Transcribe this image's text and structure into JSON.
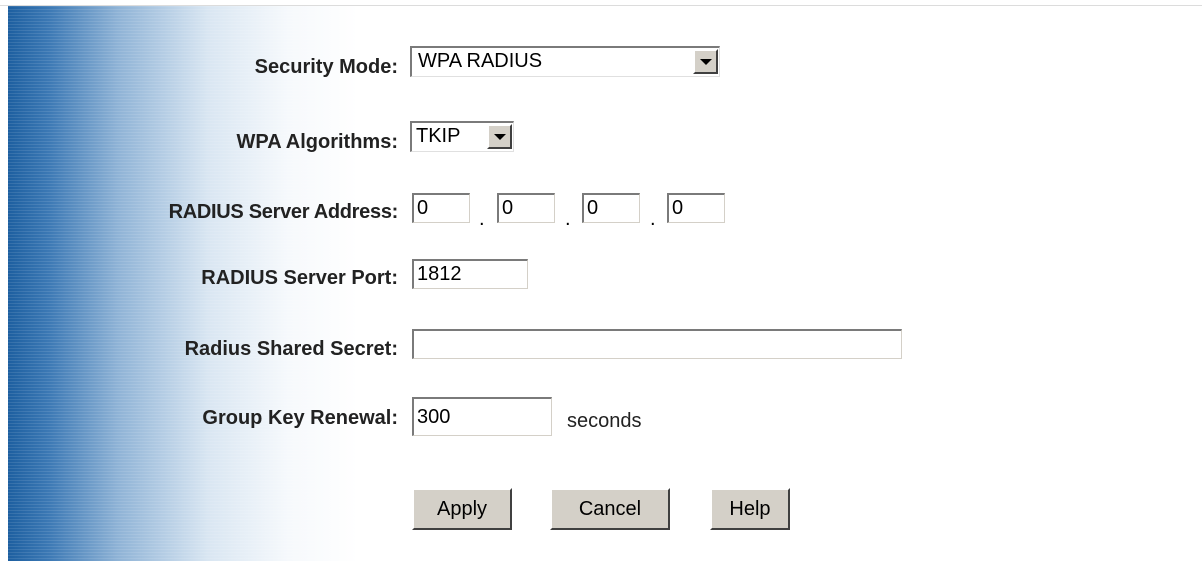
{
  "form": {
    "security_mode": {
      "label": "Security Mode:",
      "value": "WPA RADIUS"
    },
    "wpa_algorithms": {
      "label": "WPA Algorithms:",
      "value": "TKIP"
    },
    "radius_server_address": {
      "label": "RADIUS Server Address:",
      "octets": [
        "0",
        "0",
        "0",
        "0"
      ],
      "separator": "."
    },
    "radius_server_port": {
      "label": "RADIUS Server Port:",
      "value": "1812"
    },
    "radius_shared_secret": {
      "label": "Radius Shared Secret:",
      "value": ""
    },
    "group_key_renewal": {
      "label": "Group Key Renewal:",
      "value": "300",
      "unit": "seconds"
    }
  },
  "buttons": {
    "apply": "Apply",
    "cancel": "Cancel",
    "help": "Help"
  },
  "colors": {
    "sidebar_blue": "#1d5fa0",
    "button_face": "#d4d0c8"
  },
  "icons": {
    "dropdown": "chevron-down-icon"
  }
}
